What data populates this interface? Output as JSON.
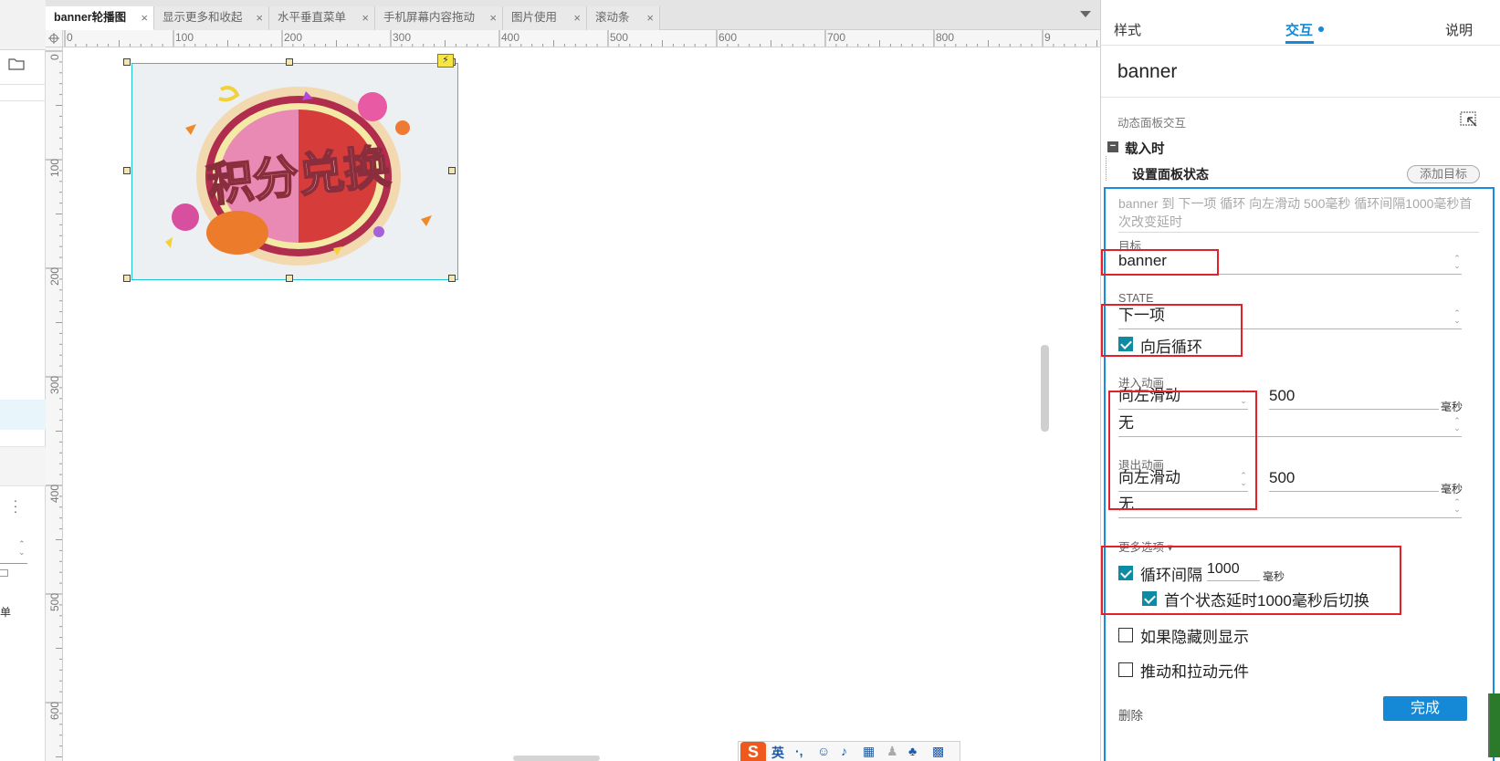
{
  "tabs": [
    {
      "label": "banner轮播图",
      "active": true
    },
    {
      "label": "显示更多和收起",
      "active": false
    },
    {
      "label": "水平垂直菜单",
      "active": false
    },
    {
      "label": "手机屏幕内容拖动",
      "active": false
    },
    {
      "label": "图片使用",
      "active": false
    },
    {
      "label": "滚动条",
      "active": false
    }
  ],
  "tab_close_glyph": "×",
  "left_strip": {
    "label": "菜单"
  },
  "ruler": {
    "h_labels": [
      "0",
      "100",
      "200",
      "300",
      "400",
      "500",
      "600",
      "700",
      "800",
      "9"
    ],
    "v_labels": [
      "0",
      "100",
      "200",
      "300",
      "400",
      "500",
      "600"
    ]
  },
  "banner_image": {
    "text": "积分兑换"
  },
  "ime": {
    "logo": "S",
    "mode": "英"
  },
  "panel": {
    "tabs": {
      "style": "样式",
      "interaction": "交互",
      "notes": "说明"
    },
    "widget_name": "banner",
    "section_title": "动态面板交互",
    "event": "载入时",
    "action": "设置面板状态",
    "add_target": "添加目标",
    "description": "banner 到 下一项 循环 向左滑动 500毫秒 循环间隔1000毫秒首次改变延时",
    "target_label": "目标",
    "target_value": "banner",
    "state_label": "STATE",
    "state_value": "下一项",
    "loop_back_label": "向后循环",
    "loop_back_checked": true,
    "enter_anim_label": "进入动画",
    "enter_anim_value": "向左滑动",
    "enter_anim_duration": "500",
    "enter_anim_second": "无",
    "exit_anim_label": "退出动画",
    "exit_anim_value": "向左滑动",
    "exit_anim_duration": "500",
    "exit_anim_second": "无",
    "unit_ms": "毫秒",
    "more_options": "更多选项 ▾",
    "loop_interval_label": "循环间隔",
    "loop_interval_value": "1000",
    "loop_interval_checked": true,
    "first_delay_label": "首个状态延时1000毫秒后切换",
    "first_delay_checked": true,
    "show_if_hidden_label": "如果隐藏则显示",
    "show_if_hidden_checked": false,
    "push_pull_label": "推动和拉动元件",
    "push_pull_checked": false,
    "delete_label": "删除",
    "done_label": "完成"
  },
  "colors": {
    "accent": "#1589d6",
    "annotation_red": "#e4202c",
    "checkbox_teal": "#0c8ba3",
    "selection_cyan": "#22c3d3"
  }
}
